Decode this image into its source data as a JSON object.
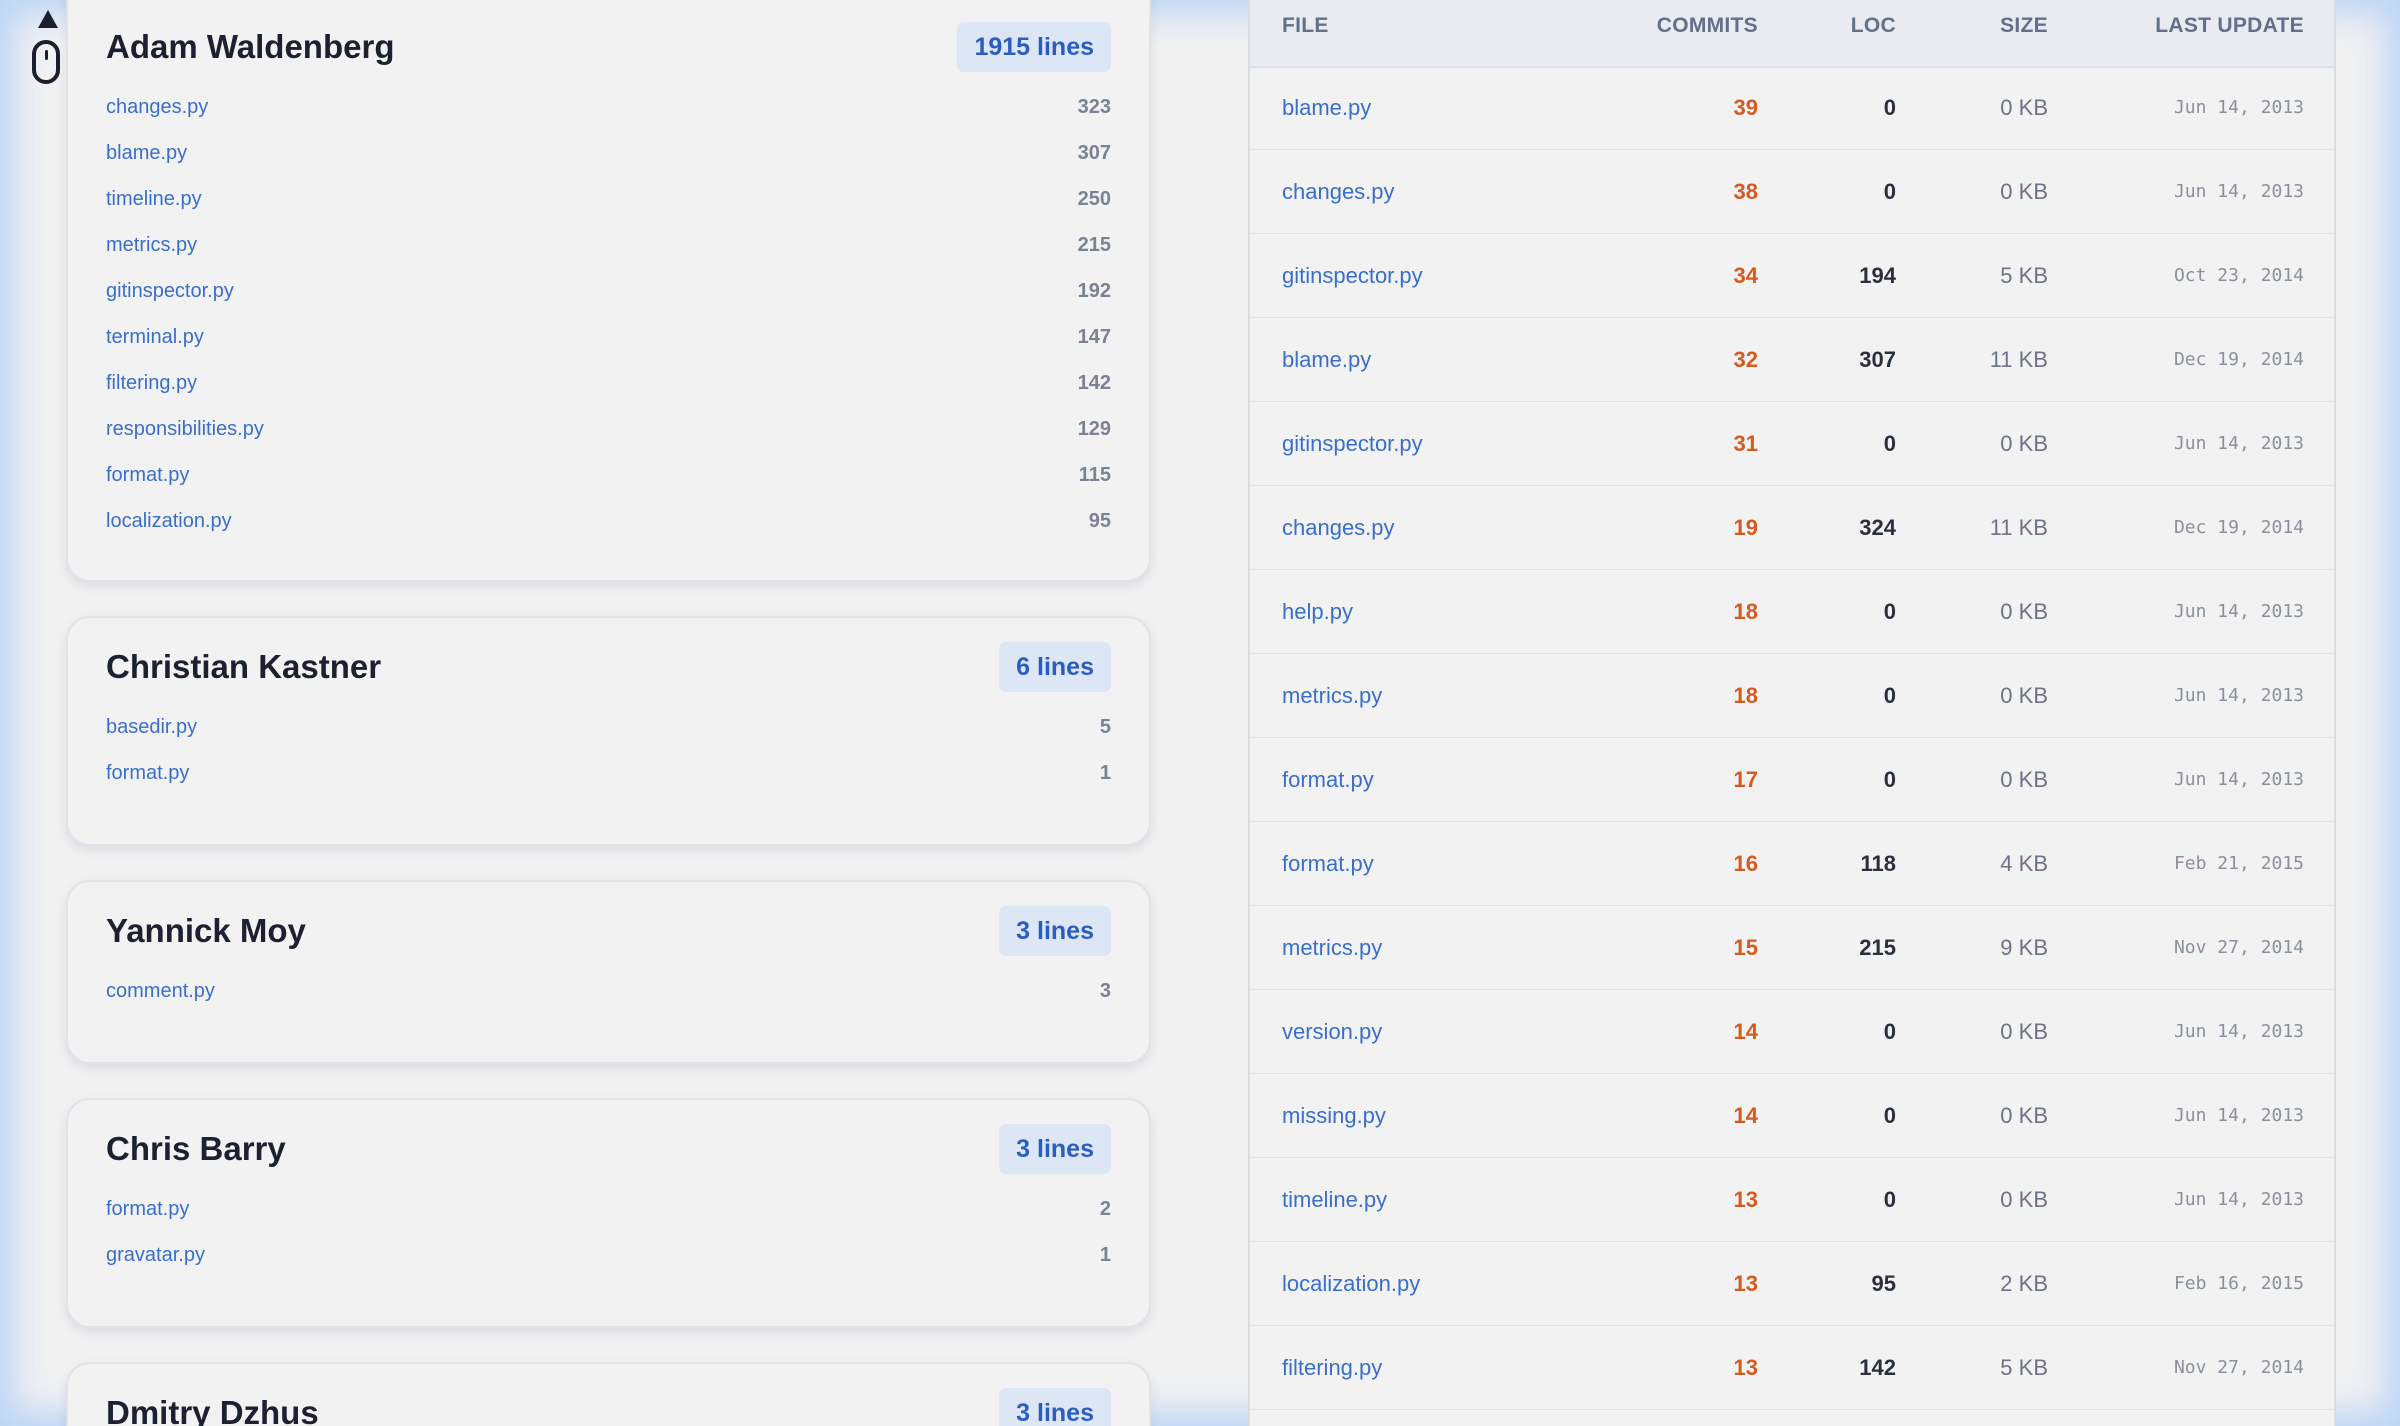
{
  "authors": [
    {
      "name": "Adam Waldenberg",
      "badge": "1915 lines",
      "files": [
        {
          "name": "changes.py",
          "lines": "323"
        },
        {
          "name": "blame.py",
          "lines": "307"
        },
        {
          "name": "timeline.py",
          "lines": "250"
        },
        {
          "name": "metrics.py",
          "lines": "215"
        },
        {
          "name": "gitinspector.py",
          "lines": "192"
        },
        {
          "name": "terminal.py",
          "lines": "147"
        },
        {
          "name": "filtering.py",
          "lines": "142"
        },
        {
          "name": "responsibilities.py",
          "lines": "129"
        },
        {
          "name": "format.py",
          "lines": "115"
        },
        {
          "name": "localization.py",
          "lines": "95"
        }
      ]
    },
    {
      "name": "Christian Kastner",
      "badge": "6 lines",
      "files": [
        {
          "name": "basedir.py",
          "lines": "5"
        },
        {
          "name": "format.py",
          "lines": "1"
        }
      ]
    },
    {
      "name": "Yannick Moy",
      "badge": "3 lines",
      "files": [
        {
          "name": "comment.py",
          "lines": "3"
        }
      ]
    },
    {
      "name": "Chris Barry",
      "badge": "3 lines",
      "files": [
        {
          "name": "format.py",
          "lines": "2"
        },
        {
          "name": "gravatar.py",
          "lines": "1"
        }
      ]
    },
    {
      "name": "Dmitry Dzhus",
      "badge": "3 lines",
      "files": []
    }
  ],
  "table": {
    "headers": {
      "file": "FILE",
      "commits": "COMMITS",
      "loc": "LOC",
      "size": "SIZE",
      "last_update": "LAST UPDATE"
    },
    "rows": [
      {
        "file": "blame.py",
        "commits": "39",
        "loc": "0",
        "size": "0 KB",
        "last_update": "Jun 14, 2013"
      },
      {
        "file": "changes.py",
        "commits": "38",
        "loc": "0",
        "size": "0 KB",
        "last_update": "Jun 14, 2013"
      },
      {
        "file": "gitinspector.py",
        "commits": "34",
        "loc": "194",
        "size": "5 KB",
        "last_update": "Oct 23, 2014"
      },
      {
        "file": "blame.py",
        "commits": "32",
        "loc": "307",
        "size": "11 KB",
        "last_update": "Dec 19, 2014"
      },
      {
        "file": "gitinspector.py",
        "commits": "31",
        "loc": "0",
        "size": "0 KB",
        "last_update": "Jun 14, 2013"
      },
      {
        "file": "changes.py",
        "commits": "19",
        "loc": "324",
        "size": "11 KB",
        "last_update": "Dec 19, 2014"
      },
      {
        "file": "help.py",
        "commits": "18",
        "loc": "0",
        "size": "0 KB",
        "last_update": "Jun 14, 2013"
      },
      {
        "file": "metrics.py",
        "commits": "18",
        "loc": "0",
        "size": "0 KB",
        "last_update": "Jun 14, 2013"
      },
      {
        "file": "format.py",
        "commits": "17",
        "loc": "0",
        "size": "0 KB",
        "last_update": "Jun 14, 2013"
      },
      {
        "file": "format.py",
        "commits": "16",
        "loc": "118",
        "size": "4 KB",
        "last_update": "Feb 21, 2015"
      },
      {
        "file": "metrics.py",
        "commits": "15",
        "loc": "215",
        "size": "9 KB",
        "last_update": "Nov 27, 2014"
      },
      {
        "file": "version.py",
        "commits": "14",
        "loc": "0",
        "size": "0 KB",
        "last_update": "Jun 14, 2013"
      },
      {
        "file": "missing.py",
        "commits": "14",
        "loc": "0",
        "size": "0 KB",
        "last_update": "Jun 14, 2013"
      },
      {
        "file": "timeline.py",
        "commits": "13",
        "loc": "0",
        "size": "0 KB",
        "last_update": "Jun 14, 2013"
      },
      {
        "file": "localization.py",
        "commits": "13",
        "loc": "95",
        "size": "2 KB",
        "last_update": "Feb 16, 2015"
      },
      {
        "file": "filtering.py",
        "commits": "13",
        "loc": "142",
        "size": "5 KB",
        "last_update": "Nov 27, 2014"
      }
    ]
  },
  "icons": {
    "scroll_up": "triangle-up-icon",
    "scroll_mouse": "mouse-icon"
  },
  "colors": {
    "accent": "#3a6fc9",
    "badge_bg": "#dce6f5",
    "commits": "#d65a1e",
    "frame_glow": "#bcd5f5"
  }
}
